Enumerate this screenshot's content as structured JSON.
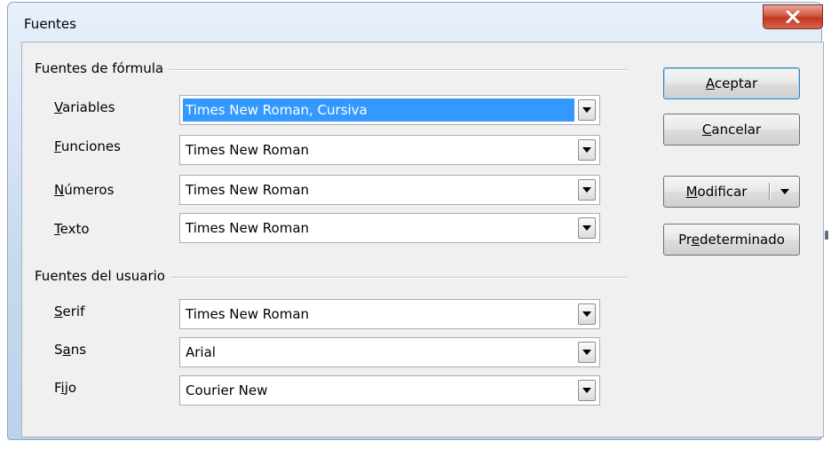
{
  "window": {
    "title": "Fuentes"
  },
  "groups": {
    "formula": {
      "title": "Fuentes de fórmula"
    },
    "user": {
      "title": "Fuentes del usuario"
    }
  },
  "fields": {
    "variables": {
      "mn": "V",
      "rest": "ariables",
      "value": "Times New Roman, Cursiva"
    },
    "funciones": {
      "mn": "F",
      "rest": "unciones",
      "value": "Times New Roman"
    },
    "numeros": {
      "mn": "N",
      "rest": "úmeros",
      "value": "Times New Roman"
    },
    "texto": {
      "mn": "T",
      "rest": "exto",
      "value": "Times New Roman"
    },
    "serif": {
      "mn": "S",
      "rest": "erif",
      "value": "Times New Roman"
    },
    "sans": {
      "pre": "S",
      "mn": "a",
      "rest": "ns",
      "value": "Arial"
    },
    "fijo": {
      "pre": "F",
      "mn": "i",
      "rest": "jo",
      "value": "Courier New"
    }
  },
  "buttons": {
    "aceptar": {
      "mn": "A",
      "rest": "ceptar"
    },
    "cancelar": {
      "mn": "C",
      "rest": "ancelar"
    },
    "modificar": {
      "mn": "M",
      "rest": "odificar"
    },
    "predeterminado": {
      "pre": "Pr",
      "mn": "e",
      "rest": "determinado"
    }
  },
  "colors": {
    "selection": "#3399ff",
    "close_button": "#c2361f"
  },
  "icons": {
    "close": "x-icon",
    "dropdown": "triangle-down-icon"
  }
}
